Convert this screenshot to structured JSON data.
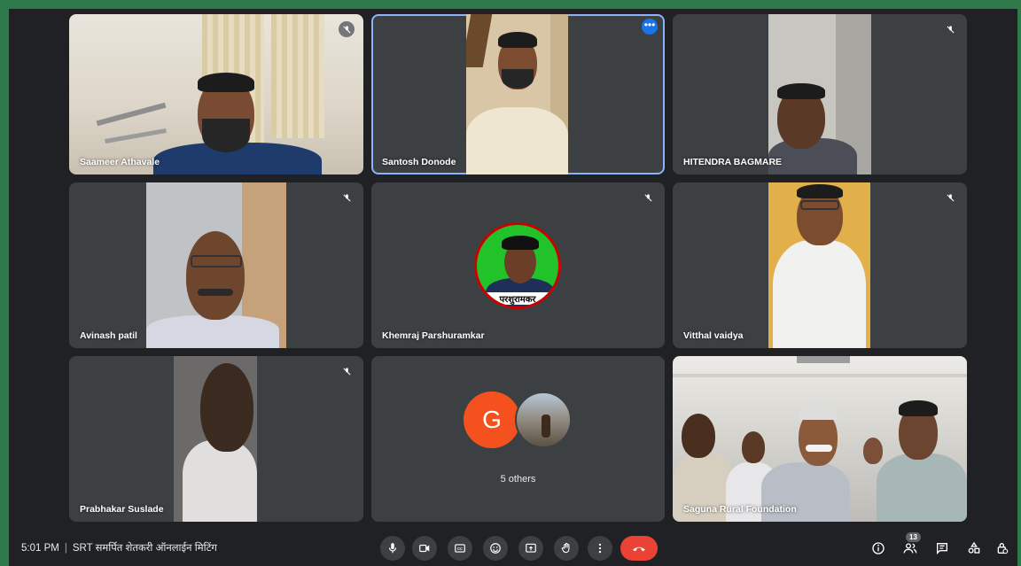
{
  "meeting": {
    "time": "5:01 PM",
    "title": "SRT समर्पित शेतकरी ऑनलाईन मिटिंग"
  },
  "participants": [
    {
      "name": "Saameer Athavale",
      "muted": true
    },
    {
      "name": "Santosh Donode",
      "muted": false,
      "active": true
    },
    {
      "name": "HITENDRA BAGMARE",
      "muted": true
    },
    {
      "name": "Avinash patil",
      "muted": true
    },
    {
      "name": "Khemraj Parshuramkar",
      "muted": true
    },
    {
      "name": "Vitthal vaidya",
      "muted": true
    },
    {
      "name": "Prabhakar Suslade",
      "muted": true
    },
    {
      "name": "Saguna Rural Foundation",
      "muted": false
    }
  ],
  "others": {
    "label": "5 others",
    "avatar_letter": "G",
    "avatar_color": "#f4511e"
  },
  "khemraj_avatar_caption": "परशुरामकर",
  "participants_count": "13",
  "colors": {
    "end_call": "#ea4335",
    "active_outline": "#8ab4f8",
    "tile_bg": "#3c4043",
    "app_bg": "#202124",
    "frame": "#2e7a4a"
  },
  "controls": [
    "microphone-icon",
    "camera-icon",
    "captions-icon",
    "emoji-icon",
    "present-icon",
    "raise-hand-icon",
    "more-options-icon",
    "end-call-icon"
  ],
  "right_controls": [
    "info-icon",
    "people-icon",
    "chat-icon",
    "activities-icon",
    "host-controls-icon"
  ]
}
